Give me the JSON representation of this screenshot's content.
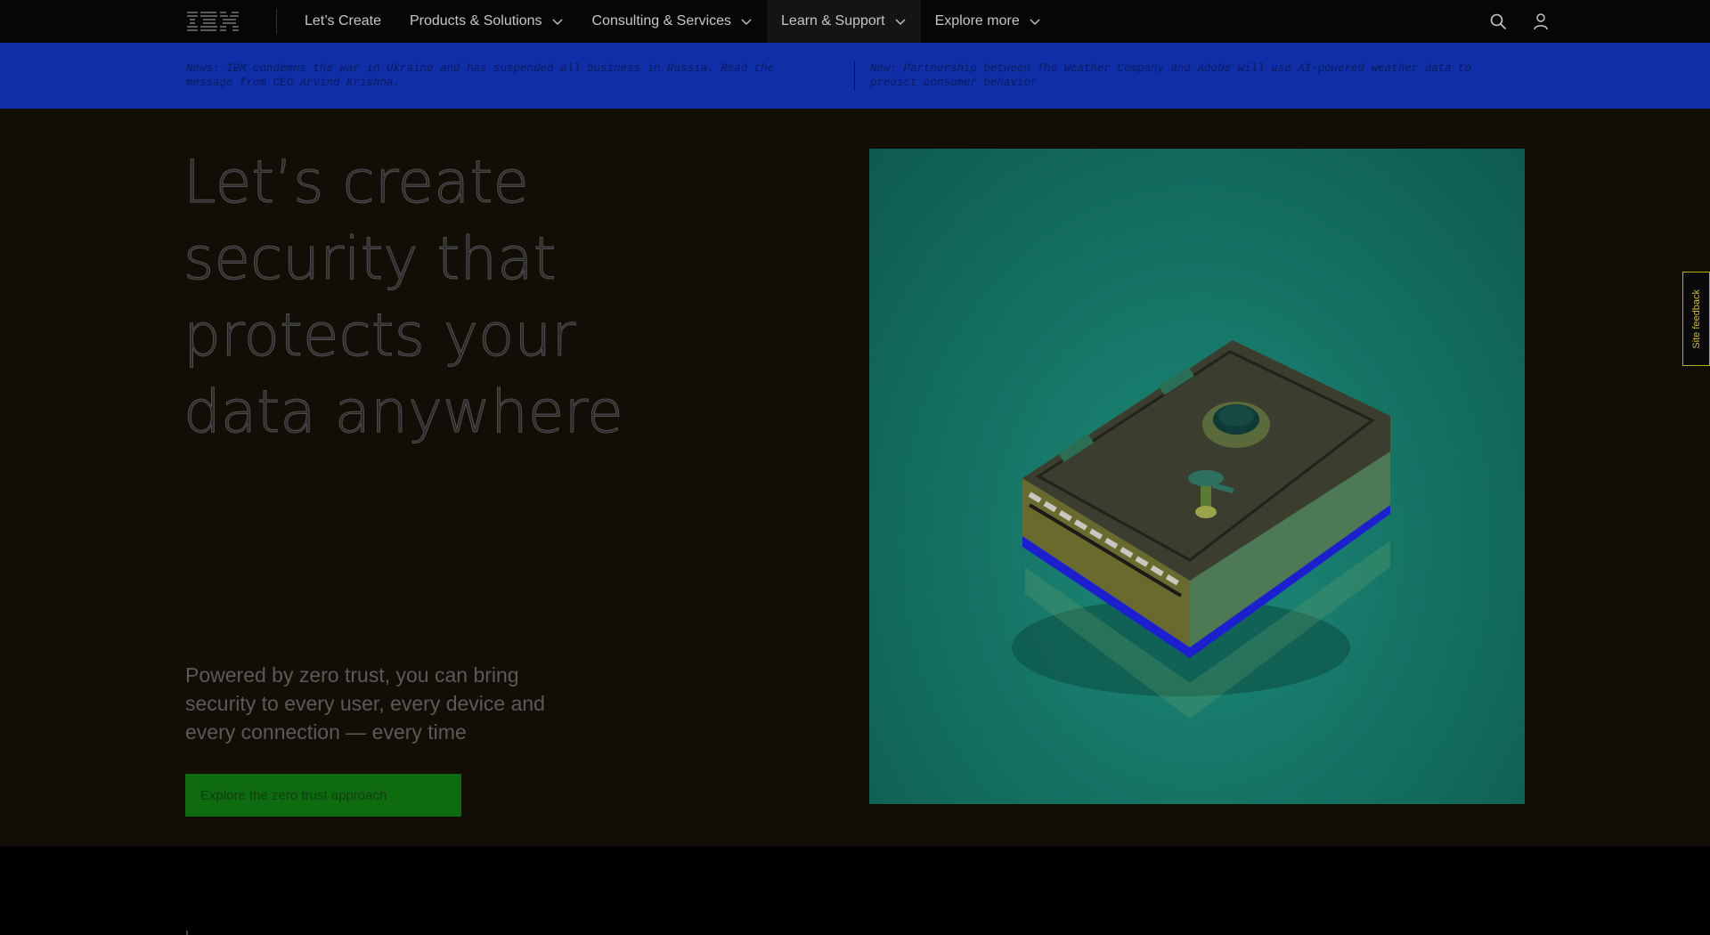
{
  "nav": {
    "logo_text": "IBM",
    "items": [
      {
        "label": "Let’s Create",
        "has_dropdown": false
      },
      {
        "label": "Products & Solutions",
        "has_dropdown": true
      },
      {
        "label": "Consulting & Services",
        "has_dropdown": true
      },
      {
        "label": "Learn & Support",
        "has_dropdown": true,
        "active": true
      },
      {
        "label": "Explore more",
        "has_dropdown": true
      }
    ],
    "icons": [
      "search-icon",
      "user-icon"
    ]
  },
  "banner": {
    "news_1": "News: IBM condemns the war in Ukraine and has suspended all business in Russia. Read the message from CEO Arvind Krishna.",
    "news_2": "New: Partnership between The Weather Company and Adobe will use AI-powered weather data to predict consumer behavior"
  },
  "hero": {
    "title": "Let’s create security that protects your data anywhere",
    "subtitle": "Powered by zero trust, you can bring security to every user, every device and every connection — every time",
    "cta_label": "Explore the zero trust approach",
    "image_subject": "safe-illustration"
  },
  "feedback": {
    "label": "Site feedback"
  },
  "colors": {
    "nav_bg": "#060606",
    "banner_bg": "#0e2fa8",
    "hero_bg": "#120d05",
    "cta_bg": "#0e6b10",
    "image_bg": "#157565",
    "feedback_border": "#b6b01e"
  }
}
